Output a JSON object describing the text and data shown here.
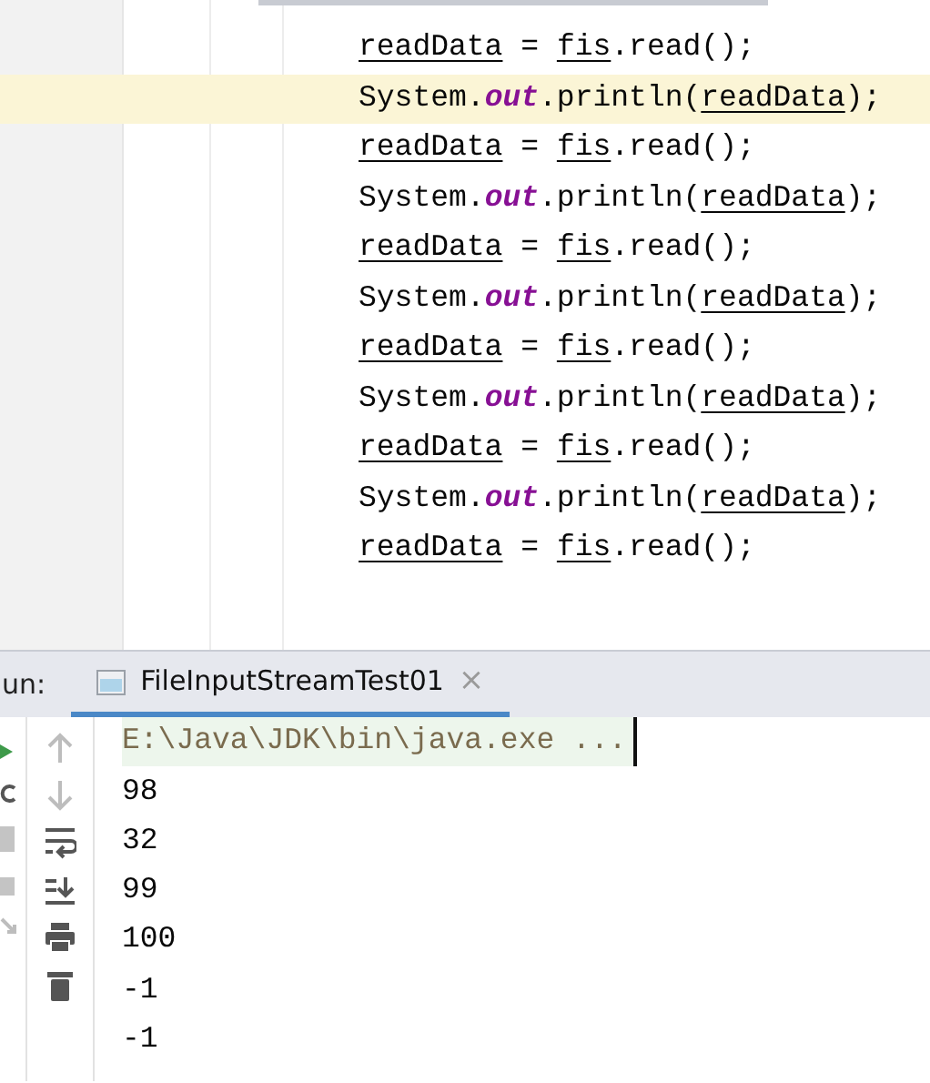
{
  "editor": {
    "lines": [
      {
        "current": false,
        "tokens": [
          {
            "text": "readData",
            "kind": "field"
          },
          {
            "text": " = ",
            "kind": "plain"
          },
          {
            "text": "fis",
            "kind": "field"
          },
          {
            "text": ".read();",
            "kind": "plain"
          }
        ]
      },
      {
        "current": true,
        "tokens": [
          {
            "text": "System.",
            "kind": "plain"
          },
          {
            "text": "out",
            "kind": "static"
          },
          {
            "text": ".println(",
            "kind": "plain"
          },
          {
            "text": "readData",
            "kind": "field"
          },
          {
            "text": ");",
            "kind": "plain"
          }
        ]
      },
      {
        "current": false,
        "tokens": [
          {
            "text": "readData",
            "kind": "field"
          },
          {
            "text": " = ",
            "kind": "plain"
          },
          {
            "text": "fis",
            "kind": "field"
          },
          {
            "text": ".read();",
            "kind": "plain"
          }
        ]
      },
      {
        "current": false,
        "tokens": [
          {
            "text": "System.",
            "kind": "plain"
          },
          {
            "text": "out",
            "kind": "static"
          },
          {
            "text": ".println(",
            "kind": "plain"
          },
          {
            "text": "readData",
            "kind": "field"
          },
          {
            "text": ");",
            "kind": "plain"
          }
        ]
      },
      {
        "current": false,
        "tokens": [
          {
            "text": "readData",
            "kind": "field"
          },
          {
            "text": " = ",
            "kind": "plain"
          },
          {
            "text": "fis",
            "kind": "field"
          },
          {
            "text": ".read();",
            "kind": "plain"
          }
        ]
      },
      {
        "current": false,
        "tokens": [
          {
            "text": "System.",
            "kind": "plain"
          },
          {
            "text": "out",
            "kind": "static"
          },
          {
            "text": ".println(",
            "kind": "plain"
          },
          {
            "text": "readData",
            "kind": "field"
          },
          {
            "text": ");",
            "kind": "plain"
          }
        ]
      },
      {
        "current": false,
        "tokens": [
          {
            "text": "readData",
            "kind": "field"
          },
          {
            "text": " = ",
            "kind": "plain"
          },
          {
            "text": "fis",
            "kind": "field"
          },
          {
            "text": ".read();",
            "kind": "plain"
          }
        ]
      },
      {
        "current": false,
        "tokens": [
          {
            "text": "System.",
            "kind": "plain"
          },
          {
            "text": "out",
            "kind": "static"
          },
          {
            "text": ".println(",
            "kind": "plain"
          },
          {
            "text": "readData",
            "kind": "field"
          },
          {
            "text": ");",
            "kind": "plain"
          }
        ]
      },
      {
        "current": false,
        "tokens": [
          {
            "text": "readData",
            "kind": "field"
          },
          {
            "text": " = ",
            "kind": "plain"
          },
          {
            "text": "fis",
            "kind": "field"
          },
          {
            "text": ".read();",
            "kind": "plain"
          }
        ]
      },
      {
        "current": false,
        "tokens": [
          {
            "text": "System.",
            "kind": "plain"
          },
          {
            "text": "out",
            "kind": "static"
          },
          {
            "text": ".println(",
            "kind": "plain"
          },
          {
            "text": "readData",
            "kind": "field"
          },
          {
            "text": ");",
            "kind": "plain"
          }
        ]
      },
      {
        "current": false,
        "tokens": [
          {
            "text": "readData",
            "kind": "field"
          },
          {
            "text": " = ",
            "kind": "plain"
          },
          {
            "text": "fis",
            "kind": "field"
          },
          {
            "text": ".read();",
            "kind": "plain"
          }
        ]
      }
    ]
  },
  "run_panel": {
    "label": "un:",
    "tabs": [
      {
        "title": "FileInputStreamTest01",
        "close": "×",
        "selected": true
      }
    ],
    "console": [
      {
        "text": "E:\\Java\\JDK\\bin\\java.exe ...",
        "kind": "command"
      },
      {
        "text": "98",
        "kind": "output"
      },
      {
        "text": "32",
        "kind": "output"
      },
      {
        "text": "99",
        "kind": "output"
      },
      {
        "text": "100",
        "kind": "output"
      },
      {
        "text": "-1",
        "kind": "output"
      },
      {
        "text": "-1",
        "kind": "output"
      }
    ]
  }
}
